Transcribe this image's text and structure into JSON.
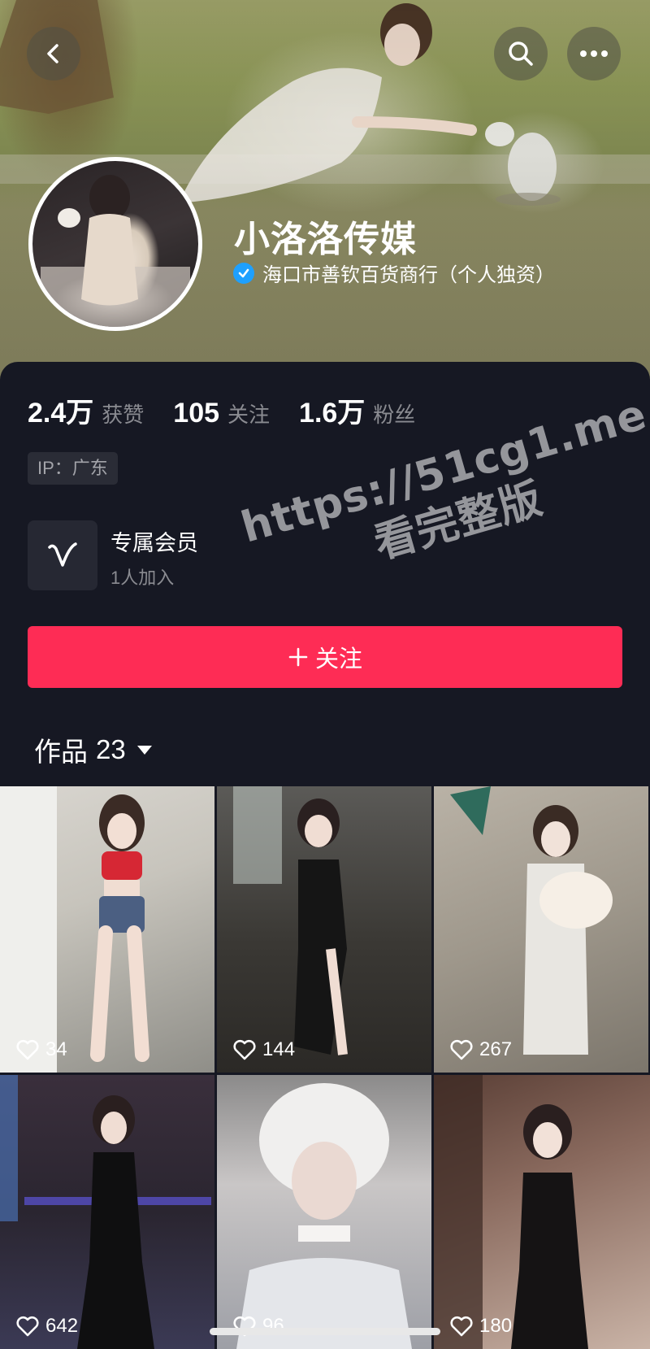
{
  "profile": {
    "name": "小洛洛传媒",
    "verified_company": "海口市善钦百货商行（个人独资）"
  },
  "stats": {
    "likes_value": "2.4万",
    "likes_label": "获赞",
    "following_value": "105",
    "following_label": "关注",
    "followers_value": "1.6万",
    "followers_label": "粉丝"
  },
  "ip": {
    "label": "IP：广东"
  },
  "membership": {
    "title": "专属会员",
    "subtitle": "1人加入"
  },
  "follow_button": {
    "icon": "plus-icon",
    "label": "关注"
  },
  "works": {
    "label": "作品",
    "count": "23"
  },
  "watermark": {
    "line1": "https://51cg1.me",
    "line2": "看完整版"
  },
  "videos": [
    {
      "likes": "34"
    },
    {
      "likes": "144"
    },
    {
      "likes": "267"
    },
    {
      "likes": "642"
    },
    {
      "likes": "96"
    },
    {
      "likes": "180"
    }
  ],
  "colors": {
    "accent": "#fe2c55",
    "background": "#161823",
    "verified": "#1ea0ff"
  }
}
